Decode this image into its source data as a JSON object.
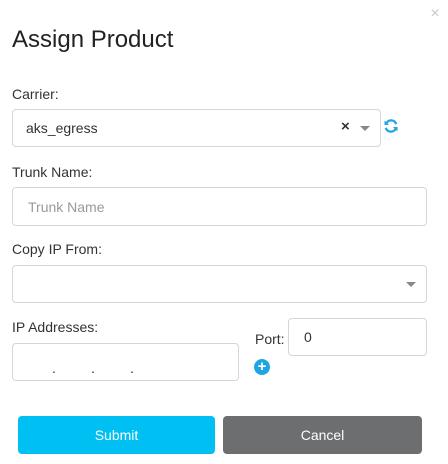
{
  "dialog": {
    "title": "Assign Product",
    "close_glyph": "×"
  },
  "carrier": {
    "label": "Carrier:",
    "selected": "aks_egress",
    "clear_glyph": "×",
    "refresh_icon": "refresh-icon"
  },
  "trunk_name": {
    "label": "Trunk Name:",
    "placeholder": "Trunk Name",
    "value": ""
  },
  "copy_ip": {
    "label": "Copy IP From:",
    "selected": ""
  },
  "ip_addresses": {
    "label": "IP Addresses:",
    "separators": [
      ".",
      ".",
      "."
    ],
    "add_icon": "plus-circle-icon"
  },
  "port": {
    "label": "Port:",
    "value": "0"
  },
  "buttons": {
    "submit": "Submit",
    "cancel": "Cancel"
  },
  "colors": {
    "submit_bg": "#00bff3",
    "cancel_bg": "#6c6e70",
    "accent": "#1fa6e2"
  }
}
